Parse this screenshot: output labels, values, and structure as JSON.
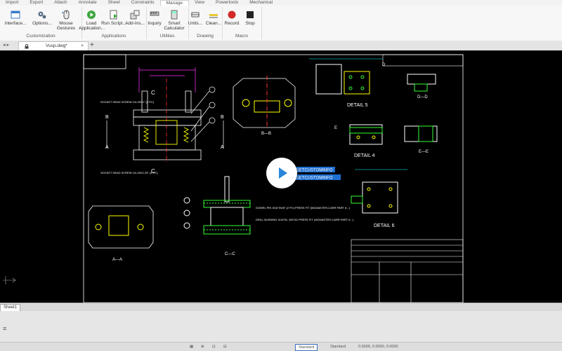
{
  "menu": {
    "items": [
      "Import",
      "Export",
      "Attach",
      "Annotate",
      "Sheet",
      "Constraints",
      "Manage",
      "View",
      "Powertools",
      "Mechanical"
    ],
    "active_index": 6
  },
  "ribbon": {
    "groups": [
      {
        "label": "Customization",
        "tools": [
          {
            "label": "Interface...",
            "icon": "interface-icon"
          },
          {
            "label": "Options...",
            "icon": "gears-icon"
          },
          {
            "label": "Mouse Gestures",
            "icon": "mouse-icon"
          }
        ]
      },
      {
        "label": "Applications",
        "tools": [
          {
            "label": "Load Application...",
            "icon": "load-app-icon"
          },
          {
            "label": "Run Script...",
            "icon": "run-script-icon"
          },
          {
            "label": "Add-Ins...",
            "icon": "addins-icon"
          }
        ]
      },
      {
        "label": "Utilities",
        "tools": [
          {
            "label": "Inquiry",
            "icon": "inquiry-icon"
          },
          {
            "label": "Smart Calculator",
            "icon": "calculator-icon"
          }
        ]
      },
      {
        "label": "Drawing",
        "tools": [
          {
            "label": "Units...",
            "icon": "units-icon"
          },
          {
            "label": "Clean...",
            "icon": "clean-icon"
          }
        ]
      },
      {
        "label": "Macro",
        "tools": [
          {
            "label": "Record",
            "icon": "record-icon"
          },
          {
            "label": "Stop",
            "icon": "stop-icon"
          }
        ]
      }
    ]
  },
  "document": {
    "tab_name": "Vusp.dwg*",
    "new_tab": "+"
  },
  "drawing": {
    "labels": {
      "detail5": "DETAIL 5",
      "detail4": "DETAIL 4",
      "detail6": "DETAIL 6",
      "bb": "B—B",
      "aa": "A—A",
      "cc": "C—C",
      "dd": "D—D",
      "ee": "E—E",
      "sec_c": "C",
      "sec_b": "B",
      "sec_a": "A",
      "sec_d": "D",
      "sec_e": "E",
      "screw1": "SOCKET HEAD SCREW\n1/4-20X1\" (2 PC)",
      "screw2": "SOCKET HEAD SCREW\n1/4-20X1.25\" (4 PC)",
      "dowel1": "DOWEL PIN 3/16\"X5/8\" (2 PC)\nPRESS FIT (MCMASTER-CARR PART #...)",
      "dowel2": "DRILL BUSHING 3/16\"ID, 3/8\"OD\nPRESS FIT (MCMASTER-CARR PART #...)",
      "field1": "GETCUSTOMINFO",
      "field2": "GETCUSTOMINFO"
    }
  },
  "sheet_tab": "Sheet1",
  "status": {
    "left": "⊲ ⊳",
    "items": [
      "▦",
      "⊕",
      "⊡",
      "⊟",
      "Standard",
      "Standard",
      "0.0000, 0.0000, 0.0000"
    ]
  },
  "colors": {
    "canvas": "#000000",
    "accent": "#2a86d8",
    "cad_white": "#ffffff",
    "cad_yellow": "#ffe900",
    "cad_magenta": "#ff33ff",
    "cad_cyan": "#00ffff",
    "cad_green": "#33ff33",
    "cad_red": "#ff3333"
  }
}
